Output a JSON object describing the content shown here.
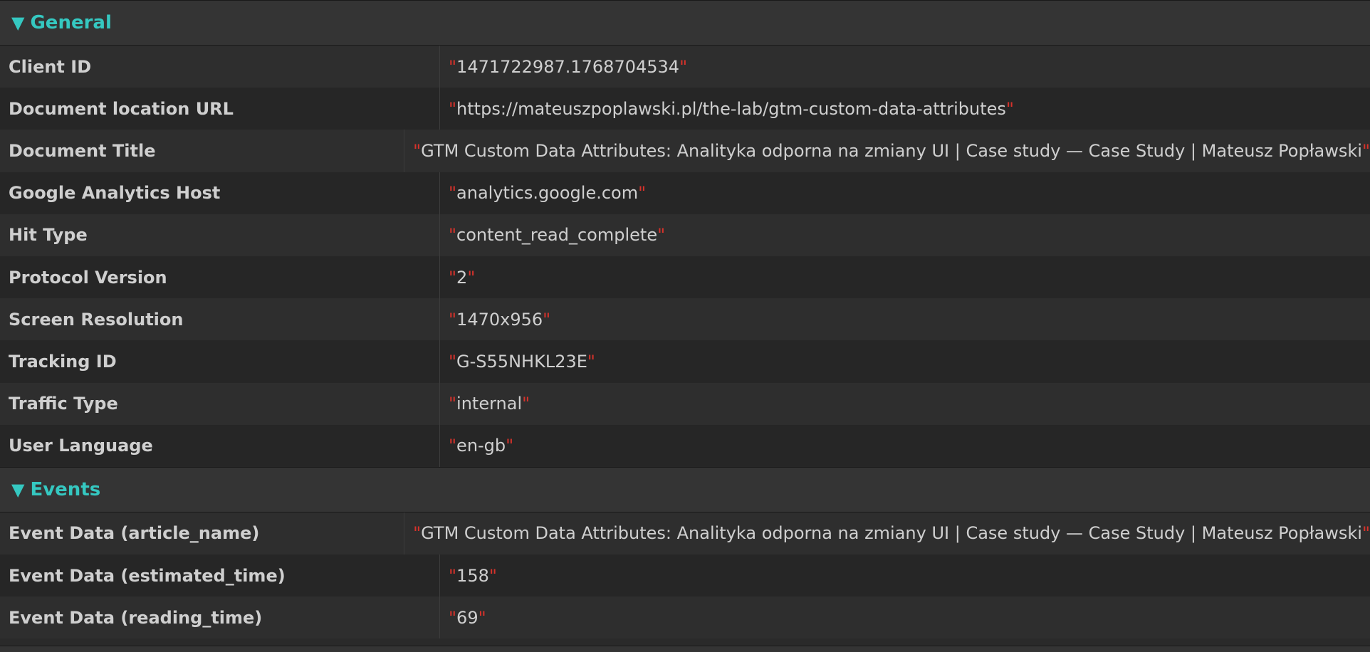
{
  "sections": [
    {
      "title": "General",
      "rows": [
        {
          "key": "Client ID",
          "value": "1471722987.1768704534"
        },
        {
          "key": "Document location URL",
          "value": "https://mateuszpoplawski.pl/the-lab/gtm-custom-data-attributes"
        },
        {
          "key": "Document Title",
          "value": "GTM Custom Data Attributes: Analityka odporna na zmiany UI | Case study — Case Study | Mateusz Popławski"
        },
        {
          "key": "Google Analytics Host",
          "value": "analytics.google.com"
        },
        {
          "key": "Hit Type",
          "value": "content_read_complete"
        },
        {
          "key": "Protocol Version",
          "value": "2"
        },
        {
          "key": "Screen Resolution",
          "value": "1470x956"
        },
        {
          "key": "Tracking ID",
          "value": "G-S55NHKL23E"
        },
        {
          "key": "Traffic Type",
          "value": "internal"
        },
        {
          "key": "User Language",
          "value": "en-gb"
        }
      ]
    },
    {
      "title": "Events",
      "rows": [
        {
          "key": "Event Data (article_name)",
          "value": "GTM Custom Data Attributes: Analityka odporna na zmiany UI | Case study — Case Study | Mateusz Popławski"
        },
        {
          "key": "Event Data (estimated_time)",
          "value": "158"
        },
        {
          "key": "Event Data (reading_time)",
          "value": "69"
        }
      ]
    }
  ],
  "quote_char": "\"",
  "colors": {
    "accent": "#35c8c1",
    "quote": "#d8322b",
    "text": "#cfcfcf",
    "background": "#2a2a2a"
  },
  "icons": {
    "expand": "triangle-down-icon"
  },
  "expand_glyph": "▼"
}
